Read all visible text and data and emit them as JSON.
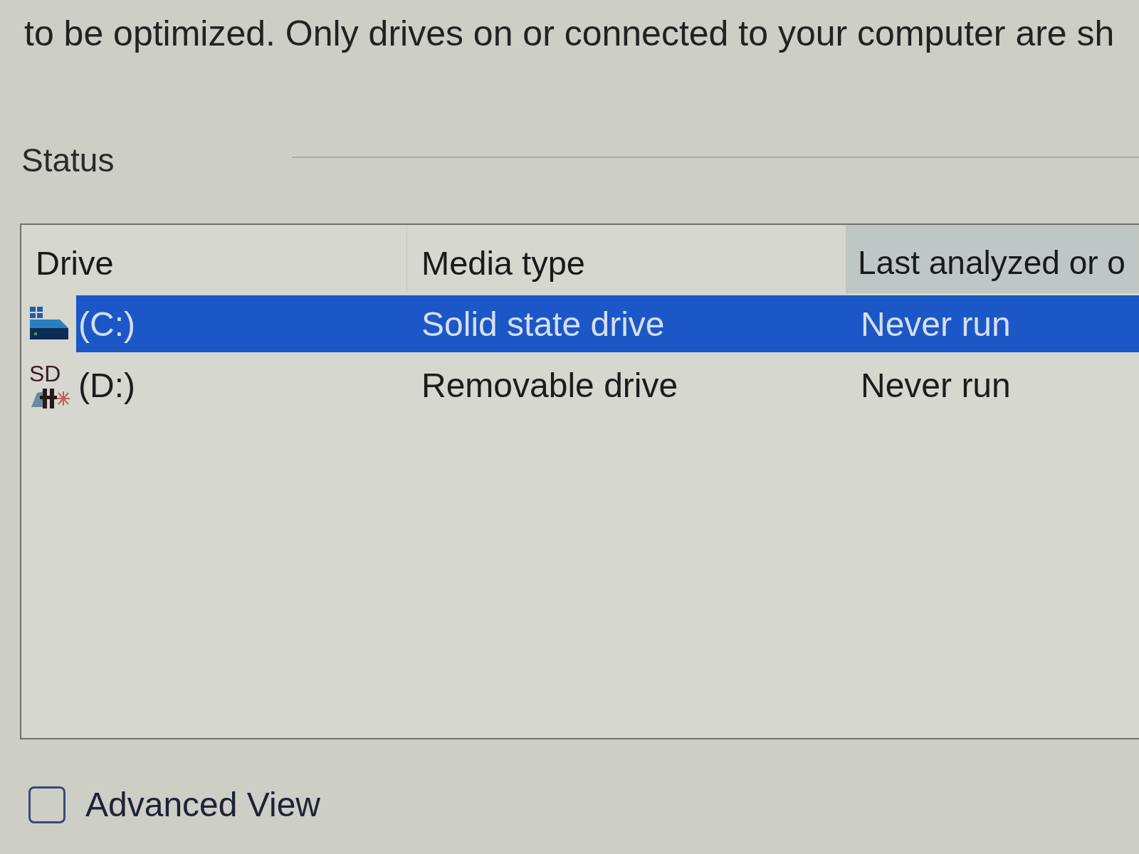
{
  "description": {
    "text": "to be optimized. Only drives on or connected to your computer are sh"
  },
  "status": {
    "label": "Status"
  },
  "drives_table": {
    "columns": [
      {
        "label": "Drive",
        "highlighted": false
      },
      {
        "label": "Media type",
        "highlighted": false
      },
      {
        "label": "Last analyzed or o",
        "highlighted": true
      }
    ],
    "rows": [
      {
        "kind": "ssd",
        "drive": "(C:)",
        "media_type": "Solid state drive",
        "last_run": "Never run",
        "selected": true
      },
      {
        "kind": "sd_card",
        "icon_text": "SD",
        "drive": "(D:)",
        "media_type": "Removable drive",
        "last_run": "Never run",
        "selected": false
      }
    ]
  },
  "advanced_view": {
    "label": "Advanced View",
    "checked": false
  }
}
